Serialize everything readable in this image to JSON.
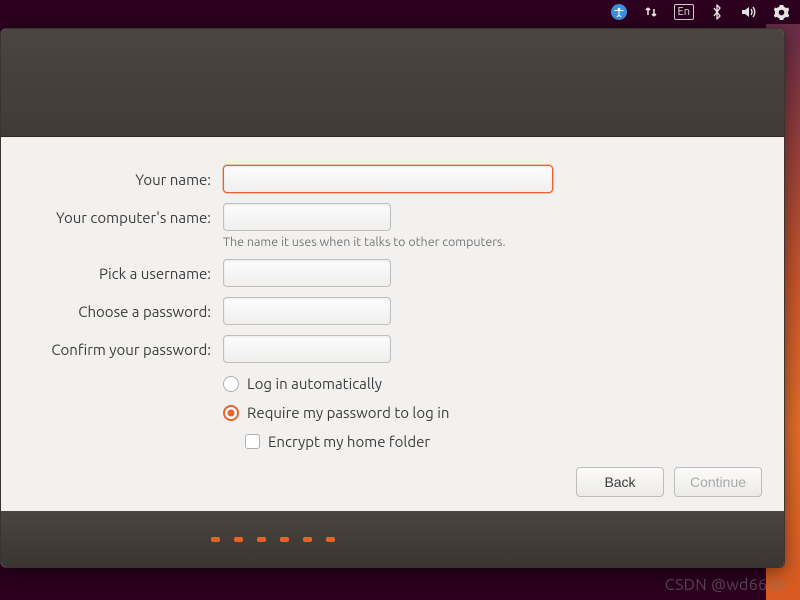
{
  "menubar": {
    "indicators": {
      "input_method": "En"
    }
  },
  "form": {
    "name": {
      "label": "Your name:",
      "value": ""
    },
    "computer": {
      "label": "Your computer's name:",
      "value": "",
      "hint": "The name it uses when it talks to other computers."
    },
    "username": {
      "label": "Pick a username:",
      "value": ""
    },
    "password": {
      "label": "Choose a password:",
      "value": ""
    },
    "confirm": {
      "label": "Confirm your password:",
      "value": ""
    },
    "login_options": {
      "auto": "Log in automatically",
      "require": "Require my password to log in",
      "selected": "require"
    },
    "encrypt": {
      "label": "Encrypt my home folder",
      "checked": false
    }
  },
  "buttons": {
    "back": "Back",
    "continue": "Continue"
  },
  "watermark": "CSDN @wd6666"
}
